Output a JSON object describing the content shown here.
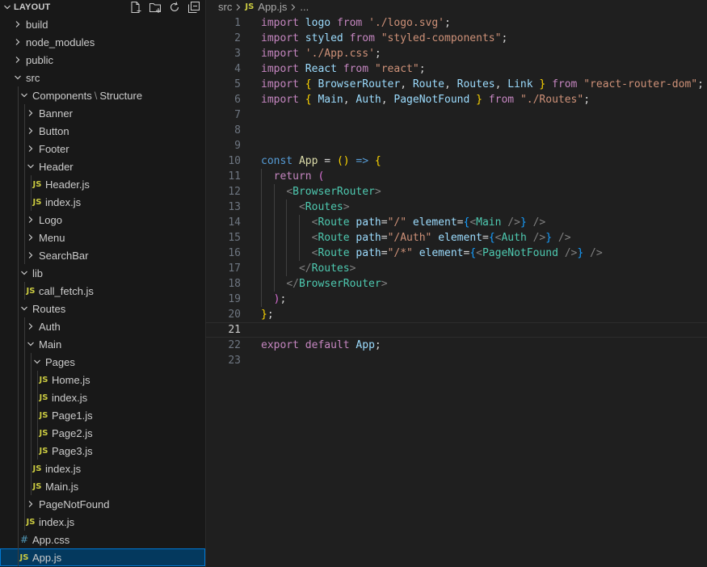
{
  "sidebar": {
    "title": "LAYOUT",
    "actions": [
      "new-file-icon",
      "new-folder-icon",
      "refresh-icon",
      "collapse-all-icon"
    ],
    "tree": [
      {
        "label": "build",
        "kind": "folder",
        "depth": 0,
        "open": false
      },
      {
        "label": "node_modules",
        "kind": "folder",
        "depth": 0,
        "open": false
      },
      {
        "label": "public",
        "kind": "folder",
        "depth": 0,
        "open": false
      },
      {
        "label": "src",
        "kind": "folder",
        "depth": 0,
        "open": true
      },
      {
        "label": "Components",
        "label2": "Structure",
        "kind": "folder",
        "depth": 1,
        "open": true
      },
      {
        "label": "Banner",
        "kind": "folder",
        "depth": 2,
        "open": false
      },
      {
        "label": "Button",
        "kind": "folder",
        "depth": 2,
        "open": false
      },
      {
        "label": "Footer",
        "kind": "folder",
        "depth": 2,
        "open": false
      },
      {
        "label": "Header",
        "kind": "folder",
        "depth": 2,
        "open": true
      },
      {
        "label": "Header.js",
        "kind": "js",
        "depth": 3
      },
      {
        "label": "index.js",
        "kind": "js",
        "depth": 3
      },
      {
        "label": "Logo",
        "kind": "folder",
        "depth": 2,
        "open": false
      },
      {
        "label": "Menu",
        "kind": "folder",
        "depth": 2,
        "open": false
      },
      {
        "label": "SearchBar",
        "kind": "folder",
        "depth": 2,
        "open": false
      },
      {
        "label": "lib",
        "kind": "folder",
        "depth": 1,
        "open": true
      },
      {
        "label": "call_fetch.js",
        "kind": "js",
        "depth": 2
      },
      {
        "label": "Routes",
        "kind": "folder",
        "depth": 1,
        "open": true
      },
      {
        "label": "Auth",
        "kind": "folder",
        "depth": 2,
        "open": false
      },
      {
        "label": "Main",
        "kind": "folder",
        "depth": 2,
        "open": true
      },
      {
        "label": "Pages",
        "kind": "folder",
        "depth": 3,
        "open": true
      },
      {
        "label": "Home.js",
        "kind": "js",
        "depth": 4
      },
      {
        "label": "index.js",
        "kind": "js",
        "depth": 4
      },
      {
        "label": "Page1.js",
        "kind": "js",
        "depth": 4
      },
      {
        "label": "Page2.js",
        "kind": "js",
        "depth": 4
      },
      {
        "label": "Page3.js",
        "kind": "js",
        "depth": 4
      },
      {
        "label": "index.js",
        "kind": "js",
        "depth": 3
      },
      {
        "label": "Main.js",
        "kind": "js",
        "depth": 3
      },
      {
        "label": "PageNotFound",
        "kind": "folder",
        "depth": 2,
        "open": false
      },
      {
        "label": "index.js",
        "kind": "js",
        "depth": 2
      },
      {
        "label": "App.css",
        "kind": "css",
        "depth": 1
      },
      {
        "label": "App.js",
        "kind": "js",
        "depth": 1,
        "selected": true
      }
    ]
  },
  "breadcrumb": {
    "folder": "src",
    "file": "App.js",
    "rest": "..."
  },
  "editor": {
    "current_line": 21,
    "lines": [
      [
        [
          "kw",
          "import"
        ],
        [
          "pl",
          " "
        ],
        [
          "id",
          "logo"
        ],
        [
          "pl",
          " "
        ],
        [
          "kw",
          "from"
        ],
        [
          "pl",
          " "
        ],
        [
          "str",
          "'./logo.svg'"
        ],
        [
          "pl",
          ";"
        ]
      ],
      [
        [
          "kw",
          "import"
        ],
        [
          "pl",
          " "
        ],
        [
          "id",
          "styled"
        ],
        [
          "pl",
          " "
        ],
        [
          "kw",
          "from"
        ],
        [
          "pl",
          " "
        ],
        [
          "str",
          "\"styled-components\""
        ],
        [
          "pl",
          ";"
        ]
      ],
      [
        [
          "kw",
          "import"
        ],
        [
          "pl",
          " "
        ],
        [
          "str",
          "'./App.css'"
        ],
        [
          "pl",
          ";"
        ]
      ],
      [
        [
          "kw",
          "import"
        ],
        [
          "pl",
          " "
        ],
        [
          "id",
          "React"
        ],
        [
          "pl",
          " "
        ],
        [
          "kw",
          "from"
        ],
        [
          "pl",
          " "
        ],
        [
          "str",
          "\"react\""
        ],
        [
          "pl",
          ";"
        ]
      ],
      [
        [
          "kw",
          "import"
        ],
        [
          "pl",
          " "
        ],
        [
          "b1",
          "{"
        ],
        [
          "pl",
          " "
        ],
        [
          "id",
          "BrowserRouter"
        ],
        [
          "pl",
          ", "
        ],
        [
          "id",
          "Route"
        ],
        [
          "pl",
          ", "
        ],
        [
          "id",
          "Routes"
        ],
        [
          "pl",
          ", "
        ],
        [
          "id",
          "Link"
        ],
        [
          "pl",
          " "
        ],
        [
          "b1",
          "}"
        ],
        [
          "pl",
          " "
        ],
        [
          "kw",
          "from"
        ],
        [
          "pl",
          " "
        ],
        [
          "str",
          "\"react-router-dom\""
        ],
        [
          "pl",
          ";"
        ]
      ],
      [
        [
          "kw",
          "import"
        ],
        [
          "pl",
          " "
        ],
        [
          "b1",
          "{"
        ],
        [
          "pl",
          " "
        ],
        [
          "id",
          "Main"
        ],
        [
          "pl",
          ", "
        ],
        [
          "id",
          "Auth"
        ],
        [
          "pl",
          ", "
        ],
        [
          "id",
          "PageNotFound"
        ],
        [
          "pl",
          " "
        ],
        [
          "b1",
          "}"
        ],
        [
          "pl",
          " "
        ],
        [
          "kw",
          "from"
        ],
        [
          "pl",
          " "
        ],
        [
          "str",
          "\"./Routes\""
        ],
        [
          "pl",
          ";"
        ]
      ],
      [],
      [],
      [],
      [
        [
          "dkw",
          "const"
        ],
        [
          "pl",
          " "
        ],
        [
          "fn",
          "App"
        ],
        [
          "pl",
          " = "
        ],
        [
          "b1",
          "("
        ],
        [
          "b1",
          ")"
        ],
        [
          "pl",
          " "
        ],
        [
          "dkw",
          "=>"
        ],
        [
          "pl",
          " "
        ],
        [
          "b1",
          "{"
        ]
      ],
      [
        [
          "pl",
          "  "
        ],
        [
          "kw",
          "return"
        ],
        [
          "pl",
          " "
        ],
        [
          "b2",
          "("
        ]
      ],
      [
        [
          "pl",
          "    "
        ],
        [
          "brk",
          "<"
        ],
        [
          "tag",
          "BrowserRouter"
        ],
        [
          "brk",
          ">"
        ]
      ],
      [
        [
          "pl",
          "      "
        ],
        [
          "brk",
          "<"
        ],
        [
          "tag",
          "Routes"
        ],
        [
          "brk",
          ">"
        ]
      ],
      [
        [
          "pl",
          "        "
        ],
        [
          "brk",
          "<"
        ],
        [
          "tag",
          "Route"
        ],
        [
          "pl",
          " "
        ],
        [
          "attr",
          "path"
        ],
        [
          "pl",
          "="
        ],
        [
          "str",
          "\"/\""
        ],
        [
          "pl",
          " "
        ],
        [
          "attr",
          "element"
        ],
        [
          "pl",
          "="
        ],
        [
          "b3",
          "{"
        ],
        [
          "brk",
          "<"
        ],
        [
          "tag",
          "Main"
        ],
        [
          "pl",
          " "
        ],
        [
          "brk",
          "/>"
        ],
        [
          "b3",
          "}"
        ],
        [
          "pl",
          " "
        ],
        [
          "brk",
          "/>"
        ]
      ],
      [
        [
          "pl",
          "        "
        ],
        [
          "brk",
          "<"
        ],
        [
          "tag",
          "Route"
        ],
        [
          "pl",
          " "
        ],
        [
          "attr",
          "path"
        ],
        [
          "pl",
          "="
        ],
        [
          "str",
          "\"/Auth\""
        ],
        [
          "pl",
          " "
        ],
        [
          "attr",
          "element"
        ],
        [
          "pl",
          "="
        ],
        [
          "b3",
          "{"
        ],
        [
          "brk",
          "<"
        ],
        [
          "tag",
          "Auth"
        ],
        [
          "pl",
          " "
        ],
        [
          "brk",
          "/>"
        ],
        [
          "b3",
          "}"
        ],
        [
          "pl",
          " "
        ],
        [
          "brk",
          "/>"
        ]
      ],
      [
        [
          "pl",
          "        "
        ],
        [
          "brk",
          "<"
        ],
        [
          "tag",
          "Route"
        ],
        [
          "pl",
          " "
        ],
        [
          "attr",
          "path"
        ],
        [
          "pl",
          "="
        ],
        [
          "str",
          "\"/*\""
        ],
        [
          "pl",
          " "
        ],
        [
          "attr",
          "element"
        ],
        [
          "pl",
          "="
        ],
        [
          "b3",
          "{"
        ],
        [
          "brk",
          "<"
        ],
        [
          "tag",
          "PageNotFound"
        ],
        [
          "pl",
          " "
        ],
        [
          "brk",
          "/>"
        ],
        [
          "b3",
          "}"
        ],
        [
          "pl",
          " "
        ],
        [
          "brk",
          "/>"
        ]
      ],
      [
        [
          "pl",
          "      "
        ],
        [
          "brk",
          "</"
        ],
        [
          "tag",
          "Routes"
        ],
        [
          "brk",
          ">"
        ]
      ],
      [
        [
          "pl",
          "    "
        ],
        [
          "brk",
          "</"
        ],
        [
          "tag",
          "BrowserRouter"
        ],
        [
          "brk",
          ">"
        ]
      ],
      [
        [
          "pl",
          "  "
        ],
        [
          "b2",
          ")"
        ],
        [
          "pl",
          ";"
        ]
      ],
      [
        [
          "b1",
          "}"
        ],
        [
          "pl",
          ";"
        ]
      ],
      [],
      [
        [
          "kw",
          "export"
        ],
        [
          "pl",
          " "
        ],
        [
          "kw",
          "default"
        ],
        [
          "pl",
          " "
        ],
        [
          "id",
          "App"
        ],
        [
          "pl",
          ";"
        ]
      ],
      []
    ]
  }
}
